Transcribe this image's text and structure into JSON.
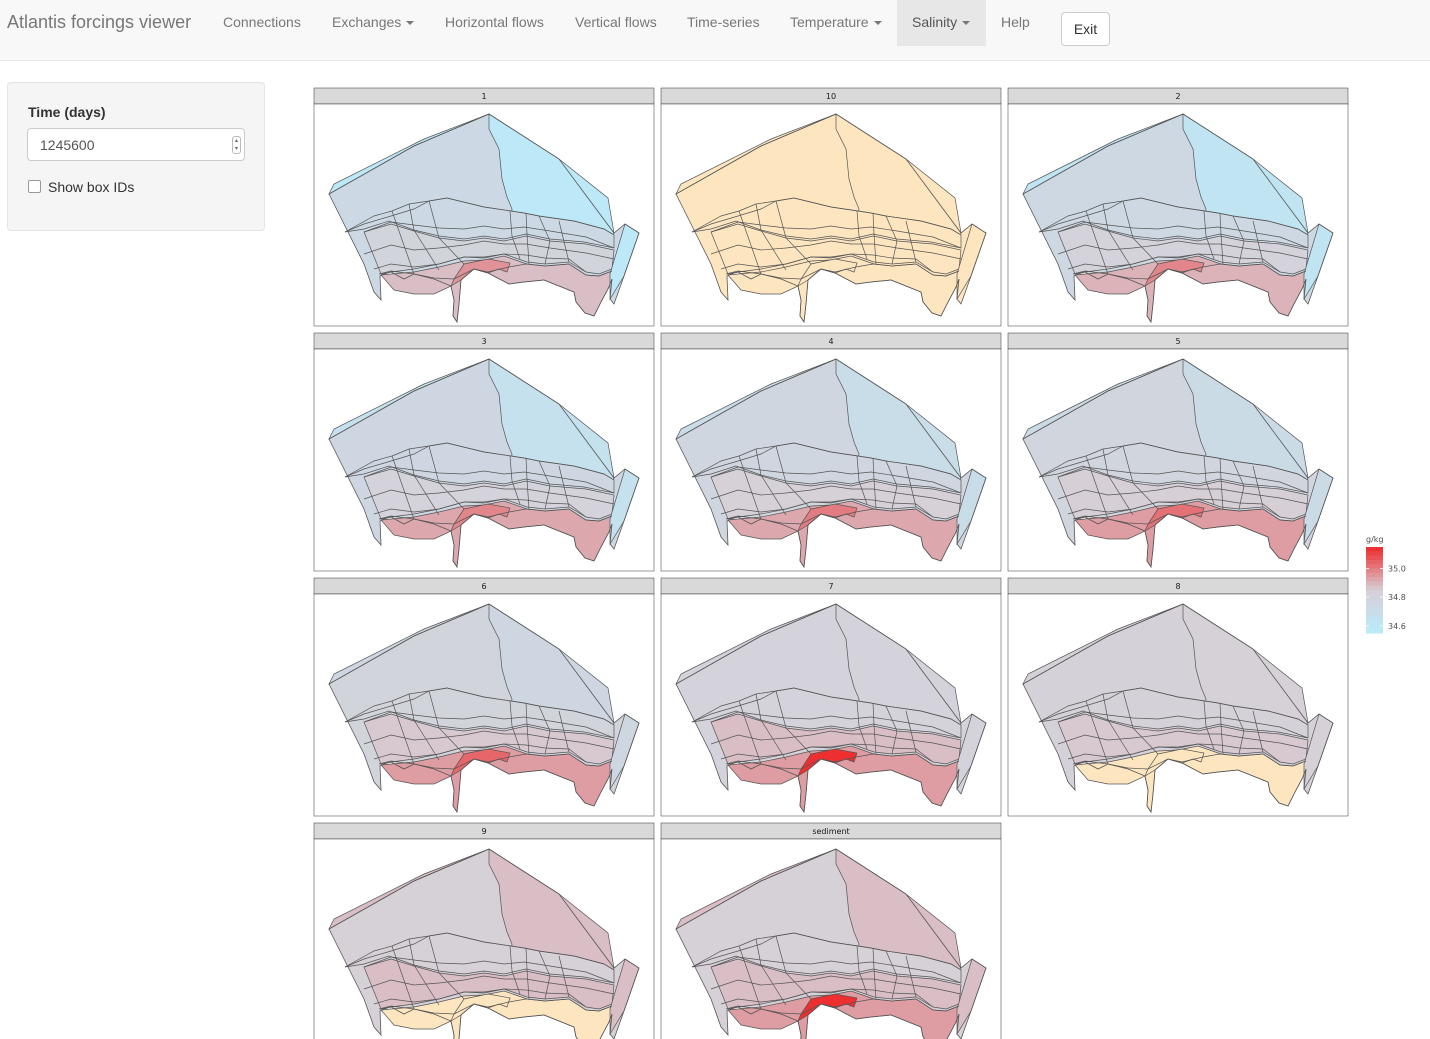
{
  "navbar": {
    "brand": "Atlantis forcings viewer",
    "items": [
      {
        "label": "Connections",
        "dropdown": false,
        "active": false
      },
      {
        "label": "Exchanges",
        "dropdown": true,
        "active": false
      },
      {
        "label": "Horizontal flows",
        "dropdown": false,
        "active": false
      },
      {
        "label": "Vertical flows",
        "dropdown": false,
        "active": false
      },
      {
        "label": "Time-series",
        "dropdown": false,
        "active": false
      },
      {
        "label": "Temperature",
        "dropdown": true,
        "active": false
      },
      {
        "label": "Salinity",
        "dropdown": true,
        "active": true
      },
      {
        "label": "Help",
        "dropdown": false,
        "active": false
      }
    ],
    "exit_label": "Exit"
  },
  "sidebar": {
    "time_label": "Time (days)",
    "time_value": "1245600",
    "show_box_ids_label": "Show box IDs",
    "show_box_ids_checked": false
  },
  "chart_data": {
    "type": "heatmap",
    "facet_labels": [
      "1",
      "10",
      "2",
      "3",
      "4",
      "5",
      "6",
      "7",
      "8",
      "9",
      "sediment"
    ],
    "legend": {
      "title": "g/kg",
      "ticks": [
        35.0,
        34.8,
        34.6
      ],
      "tick_labels": [
        "35.0",
        "34.8",
        "34.6"
      ],
      "range": [
        34.55,
        35.15
      ],
      "colors": {
        "low": "#b9ebfb",
        "mid": "#d7cfd6",
        "high": "#ee2a2a"
      },
      "placement": "right"
    },
    "fresh_color": "#fde5c0",
    "facets": [
      {
        "label": "1",
        "shelf": 34.58,
        "mid": 34.74,
        "inner": 34.8,
        "coast": 34.88,
        "hot": 34.96
      },
      {
        "label": "10",
        "shelf": null,
        "mid": null,
        "inner": null,
        "coast": null,
        "hot": null
      },
      {
        "label": "2",
        "shelf": 34.62,
        "mid": 34.75,
        "inner": 34.82,
        "coast": 34.9,
        "hot": 34.98
      },
      {
        "label": "3",
        "shelf": 34.66,
        "mid": 34.76,
        "inner": 34.82,
        "coast": 34.92,
        "hot": 34.98
      },
      {
        "label": "4",
        "shelf": 34.7,
        "mid": 34.78,
        "inner": 34.84,
        "coast": 34.92,
        "hot": 35.0
      },
      {
        "label": "5",
        "shelf": 34.72,
        "mid": 34.79,
        "inner": 34.85,
        "coast": 34.94,
        "hot": 35.02
      },
      {
        "label": "6",
        "shelf": 34.76,
        "mid": 34.8,
        "inner": 34.86,
        "coast": 34.94,
        "hot": 35.04
      },
      {
        "label": "7",
        "shelf": 34.82,
        "mid": 34.82,
        "inner": 34.88,
        "coast": 34.94,
        "hot": 35.14
      },
      {
        "label": "8",
        "shelf": 34.84,
        "mid": 34.83,
        "inner": 34.86,
        "coast": null,
        "hot": null
      },
      {
        "label": "9",
        "shelf": 34.88,
        "mid": 34.84,
        "inner": 34.88,
        "coast": null,
        "hot": null
      },
      {
        "label": "sediment",
        "shelf": 34.88,
        "mid": 34.84,
        "inner": 34.88,
        "coast": 34.94,
        "hot": 35.14
      }
    ]
  }
}
